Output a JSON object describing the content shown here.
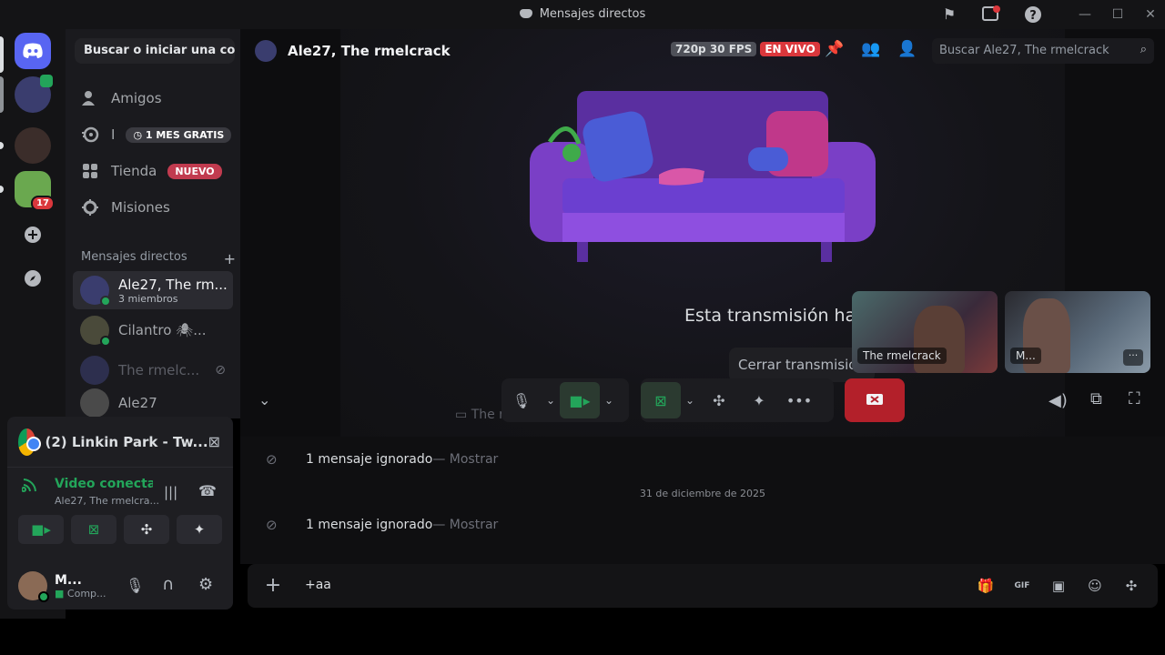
{
  "window": {
    "title": "Mensajes directos"
  },
  "rail": {
    "notification_count": "17"
  },
  "sidebar": {
    "search_label": "Buscar o iniciar una co...",
    "nav": [
      {
        "label": "Amigos",
        "icon": "friends-icon"
      },
      {
        "label": "I",
        "icon": "nitro-icon",
        "badge": "1 MES GRATIS"
      },
      {
        "label": "Tienda",
        "icon": "shop-icon",
        "badge": "NUEVO"
      },
      {
        "label": "Misiones",
        "icon": "quests-icon"
      }
    ],
    "dm_header": "Mensajes directos",
    "dms": [
      {
        "name": "Ale27, The rm...",
        "sub": "3 miembros"
      },
      {
        "name": "Cilantro 🕷..."
      },
      {
        "name": "The rmelc..."
      },
      {
        "name": "Ale27"
      }
    ]
  },
  "voice_panel": {
    "stream_title": "(2) Linkin Park - Tw...",
    "status": "Video conectad",
    "channel": "Ale27, The rmelcra..."
  },
  "user": {
    "name": "M...",
    "status": "Comp..."
  },
  "chat_header": {
    "title": "Ale27, The rmelcrack",
    "quality": "720p 30 FPS",
    "live": "EN VIVO",
    "search_placeholder": "Buscar Ale27, The rmelcrack"
  },
  "stream": {
    "ended_text": "Esta transmisión ha finalizado.",
    "close_button": "Cerrar transmisión",
    "stream_owner": "The rmelcrack",
    "tiles": [
      {
        "label": "The rmelcrack"
      },
      {
        "label": "M..."
      }
    ]
  },
  "messages": {
    "ignored_1": "1 mensaje ignorado",
    "show_1": " — Mostrar",
    "date": "31 de diciembre de 2025",
    "ignored_2": "1 mensaje ignorado",
    "show_2": " — Mostrar"
  },
  "composer": {
    "text": "+aa"
  },
  "colors": {
    "brand": "#5865f2",
    "green": "#23a55a",
    "red": "#da373c",
    "nuevo": "#c13b4f"
  }
}
